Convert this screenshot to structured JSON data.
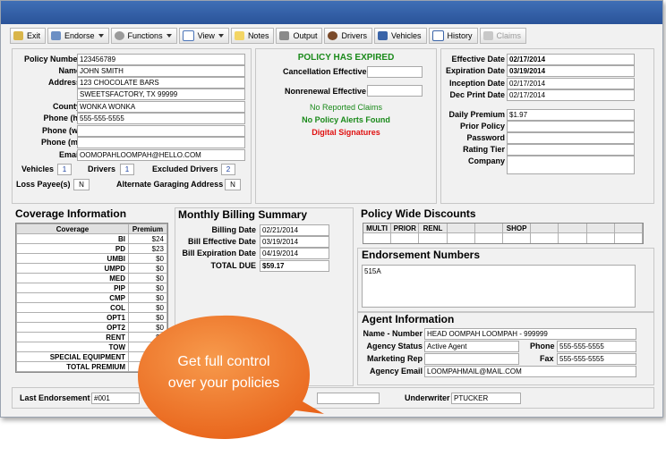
{
  "toolbar": {
    "exit": "Exit",
    "endorse": "Endorse",
    "functions": "Functions",
    "view": "View",
    "notes": "Notes",
    "output": "Output",
    "drivers": "Drivers",
    "vehicles": "Vehicles",
    "history": "History",
    "claims": "Claims"
  },
  "policy": {
    "labels": {
      "policy_number": "Policy Number",
      "name": "Name",
      "address": "Address",
      "county": "County",
      "phone_h": "Phone (h)",
      "phone_w": "Phone (w)",
      "phone_m": "Phone (m)",
      "email": "Email",
      "vehicles": "Vehicles",
      "drivers": "Drivers",
      "excluded_drivers": "Excluded Drivers",
      "loss_payee": "Loss Payee(s)",
      "alt_garaging": "Alternate Garaging Address"
    },
    "policy_number": "123456789",
    "name": "JOHN SMITH",
    "address1": "123 CHOCOLATE BARS",
    "address2": "SWEETSFACTORY, TX 99999",
    "county": "WONKA WONKA",
    "phone_h": "555-555-5555",
    "phone_w": "",
    "phone_m": "",
    "email": "OOMOPAHLOOMPAH@HELLO.COM",
    "vehicles": "1",
    "drivers": "1",
    "excluded_drivers": "2",
    "loss_payee": "N",
    "alt_garaging": "N"
  },
  "status": {
    "expired": "POLICY HAS EXPIRED",
    "cancel_label": "Cancellation Effective",
    "nonrenew_label": "Nonrenewal Effective",
    "no_claims": "No Reported Claims",
    "no_alerts": "No Policy Alerts Found",
    "digital_signatures": "Digital Signatures",
    "colors": {
      "green": "#1a8a1a",
      "red": "#e01010"
    }
  },
  "dates": {
    "labels": {
      "effective": "Effective Date",
      "expiration": "Expiration Date",
      "inception": "Inception Date",
      "dec_print": "Dec Print Date",
      "daily_premium": "Daily Premium",
      "prior_policy": "Prior Policy",
      "password": "Password",
      "rating_tier": "Rating Tier",
      "company": "Company"
    },
    "effective": "02/17/2014",
    "expiration": "03/19/2014",
    "inception": "02/17/2014",
    "dec_print": "02/17/2014",
    "daily_premium": "$1.97"
  },
  "coverage": {
    "title": "Coverage Information",
    "col_coverage": "Coverage",
    "col_premium": "Premium",
    "rows": [
      {
        "name": "BI",
        "premium": "$24"
      },
      {
        "name": "PD",
        "premium": "$23"
      },
      {
        "name": "UMBI",
        "premium": "$0"
      },
      {
        "name": "UMPD",
        "premium": "$0"
      },
      {
        "name": "MED",
        "premium": "$0"
      },
      {
        "name": "PIP",
        "premium": "$0"
      },
      {
        "name": "CMP",
        "premium": "$0"
      },
      {
        "name": "COL",
        "premium": "$0"
      },
      {
        "name": "OPT1",
        "premium": "$0"
      },
      {
        "name": "OPT2",
        "premium": "$0"
      },
      {
        "name": "RENT",
        "premium": "$0"
      },
      {
        "name": "TOW",
        "premium": ""
      },
      {
        "name": "SPECIAL EQUIPMENT",
        "premium": ""
      },
      {
        "name": "TOTAL PREMIUM",
        "premium": "$"
      }
    ]
  },
  "billing": {
    "title": "Monthly Billing Summary",
    "labels": {
      "billing_date": "Billing Date",
      "bill_effective": "Bill Effective Date",
      "bill_expiration": "Bill Expiration Date",
      "total_due": "TOTAL DUE"
    },
    "billing_date": "02/21/2014",
    "bill_effective": "03/19/2014",
    "bill_expiration": "04/19/2014",
    "total_due": "$59.17"
  },
  "discounts": {
    "title": "Policy Wide Discounts",
    "headers": [
      "MULTI",
      "PRIOR",
      "RENL",
      "",
      "",
      "SHOP",
      "",
      "",
      "",
      ""
    ]
  },
  "endorsement": {
    "title": "Endorsement Numbers",
    "value": "515A"
  },
  "agent": {
    "title": "Agent Information",
    "labels": {
      "name_number": "Name - Number",
      "agency_status": "Agency Status",
      "phone": "Phone",
      "marketing_rep": "Marketing Rep",
      "fax": "Fax",
      "agency_email": "Agency Email"
    },
    "name_number": "HEAD OOMPAH LOOMPAH - 999999",
    "agency_status": "Active Agent",
    "phone": "555-555-5555",
    "marketing_rep": "",
    "fax": "555-555-5555",
    "agency_email": "LOOMPAHMAIL@MAIL.COM"
  },
  "footer": {
    "last_endorsement_label": "Last Endorsement",
    "last_endorsement": "#001",
    "underwriter_label": "Underwriter",
    "underwriter": "PTUCKER"
  },
  "callout": {
    "line1": "Get full control",
    "line2": "over your policies",
    "color": "#f07a2a"
  }
}
